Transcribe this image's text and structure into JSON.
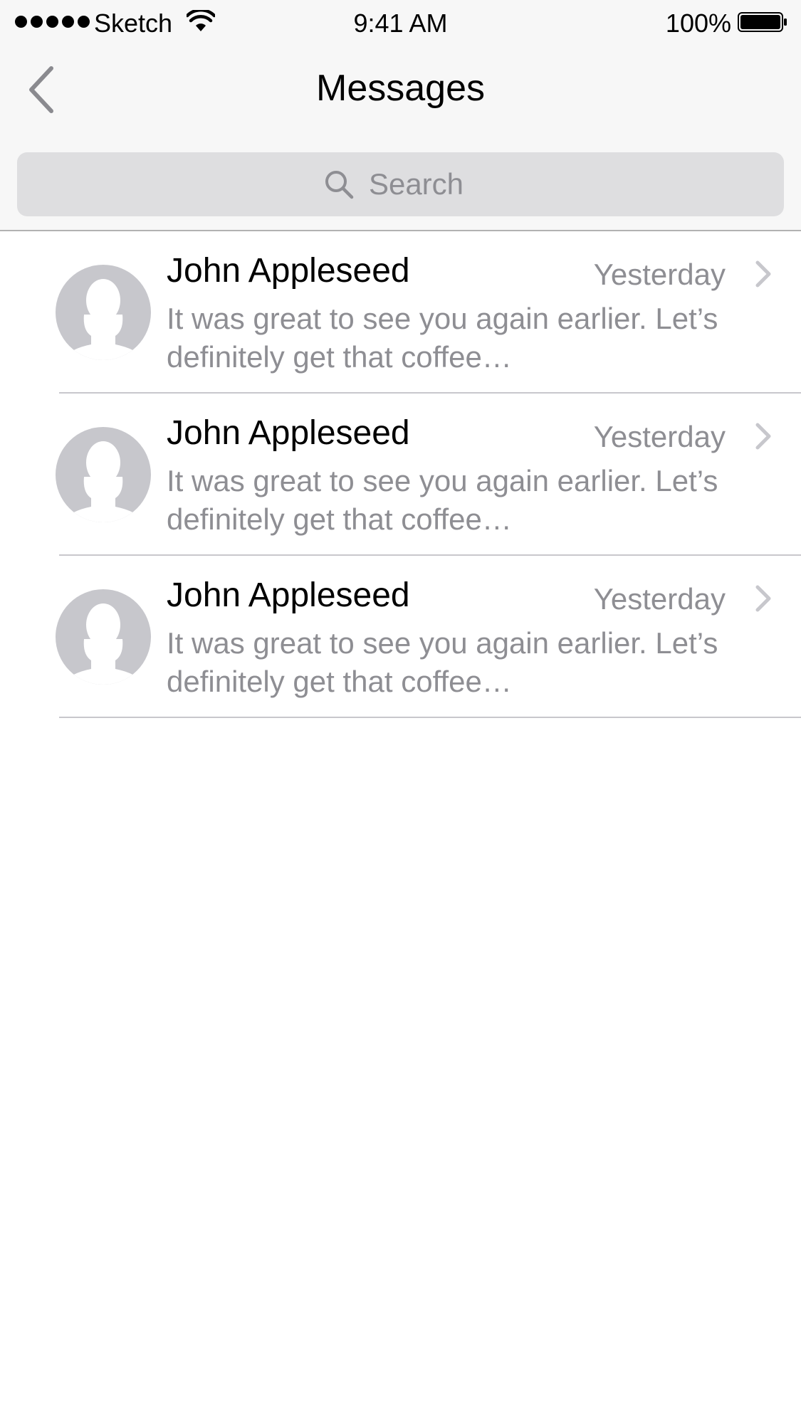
{
  "status_bar": {
    "carrier": "Sketch",
    "time": "9:41 AM",
    "battery_percent": "100%",
    "signal_bars": 5,
    "icons": [
      "signal-dots",
      "wifi-icon",
      "battery-icon"
    ]
  },
  "nav": {
    "title": "Messages",
    "back_icon": "chevron-left-icon"
  },
  "search": {
    "placeholder": "Search",
    "icon": "search-icon"
  },
  "messages": [
    {
      "sender": "John Appleseed",
      "timestamp": "Yesterday",
      "preview_line1": "It was great to see you again earlier. Let’s",
      "preview_line2": "definitely get that coffee…",
      "avatar_icon": "person-placeholder-icon",
      "disclosure_icon": "chevron-right-icon"
    },
    {
      "sender": "John Appleseed",
      "timestamp": "Yesterday",
      "preview_line1": "It was great to see you again earlier. Let’s",
      "preview_line2": "definitely get that coffee…",
      "avatar_icon": "person-placeholder-icon",
      "disclosure_icon": "chevron-right-icon"
    },
    {
      "sender": "John Appleseed",
      "timestamp": "Yesterday",
      "preview_line1": "It was great to see you again earlier. Let’s",
      "preview_line2": "definitely get that coffee…",
      "avatar_icon": "person-placeholder-icon",
      "disclosure_icon": "chevron-right-icon"
    }
  ],
  "colors": {
    "chrome_background": "#f7f7f7",
    "search_field": "#dedee0",
    "secondary_text": "#8e8e93",
    "separator": "#c8c7cc",
    "avatar_fill": "#c7c7cc",
    "chevron": "#c7c7cc"
  }
}
